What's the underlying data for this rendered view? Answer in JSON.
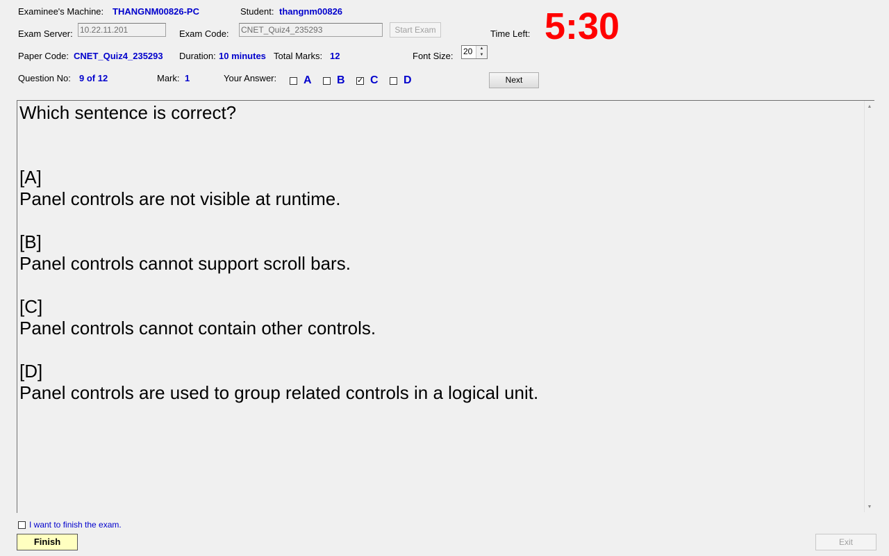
{
  "header": {
    "machine_label": "Examinee's Machine:",
    "machine_value": "THANGNM00826-PC",
    "student_label": "Student:",
    "student_value": "thangnm00826",
    "server_label": "Exam Server:",
    "server_value": "10.22.11.201",
    "exam_code_label": "Exam Code:",
    "exam_code_value": "CNET_Quiz4_235293",
    "start_exam_label": "Start Exam",
    "time_left_label": "Time Left:",
    "time_left_value": "5:30",
    "paper_code_label": "Paper Code:",
    "paper_code_value": "CNET_Quiz4_235293",
    "duration_label": "Duration:",
    "duration_value": "10 minutes",
    "total_marks_label": "Total Marks:",
    "total_marks_value": "12",
    "font_size_label": "Font Size:",
    "font_size_value": "20",
    "question_no_label": "Question No:",
    "question_no_value": "9 of 12",
    "mark_label": "Mark:",
    "mark_value": "1",
    "your_answer_label": "Your Answer:",
    "next_label": "Next"
  },
  "answers": [
    {
      "letter": "A",
      "checked": false
    },
    {
      "letter": "B",
      "checked": false
    },
    {
      "letter": "C",
      "checked": true
    },
    {
      "letter": "D",
      "checked": false
    }
  ],
  "question": {
    "text": "Which sentence is correct?",
    "options": [
      {
        "tag": "[A]",
        "text": "Panel controls are not visible at runtime."
      },
      {
        "tag": "[B]",
        "text": "Panel controls cannot support scroll bars."
      },
      {
        "tag": "[C]",
        "text": "Panel controls cannot contain other controls."
      },
      {
        "tag": "[D]",
        "text": "Panel controls are used to group related controls in a logical unit."
      }
    ]
  },
  "footer": {
    "finish_check_label": "I want to finish the exam.",
    "finish_check_checked": false,
    "finish_label": "Finish",
    "exit_label": "Exit"
  },
  "colors": {
    "accent_blue": "#0000cc",
    "timer_red": "#ff0000",
    "finish_button_bg": "#ffffc0",
    "window_bg": "#f0f0f0"
  }
}
